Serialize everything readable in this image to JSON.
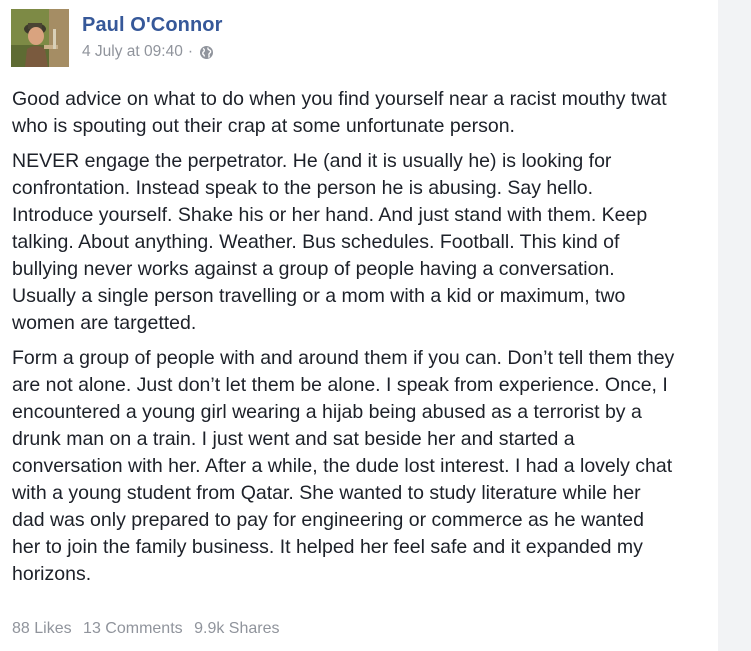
{
  "post": {
    "author": "Paul O'Connor",
    "date": "4 July at 09:40",
    "separator": "·",
    "privacy_icon": "globe-icon",
    "paragraphs": [
      "Good advice on what to do when you find yourself near a racist mouthy twat\nwho is spouting out their crap at some unfortunate person.",
      "NEVER engage the perpetrator. He (and it is usually he) is looking for\nconfrontation. Instead speak to the person he is abusing. Say hello.\nIntroduce yourself. Shake his or her hand. And just stand with them. Keep\ntalking. About anything. Weather. Bus schedules. Football. This kind of\nbullying never works against a group of people having a conversation.\nUsually a single person travelling or a mom with a kid or maximum, two\nwomen are targetted.",
      "Form a group of people with and around them if you can. Don’t tell them they\nare not alone. Just don’t let them be alone. I speak from experience. Once, I\nencountered a young girl wearing a hijab being abused as a terrorist by a\ndrunk man on a train. I just went and sat beside her and started a\nconversation with her. After a while, the dude lost interest. I had a lovely chat\nwith a young student from Qatar. She wanted to study literature while her\ndad was only prepared to pay for engineering or commerce as he wanted\nher to join the family business. It helped her feel safe and it expanded my\nhorizons."
    ]
  },
  "stats": {
    "likes": "88 Likes",
    "comments": "13 Comments",
    "shares": "9.9k Shares"
  },
  "colors": {
    "author_link": "#365899",
    "meta_text": "#90949c",
    "body_text": "#1d2129",
    "card_bg": "#ffffff",
    "page_bg": "#f2f3f5"
  }
}
